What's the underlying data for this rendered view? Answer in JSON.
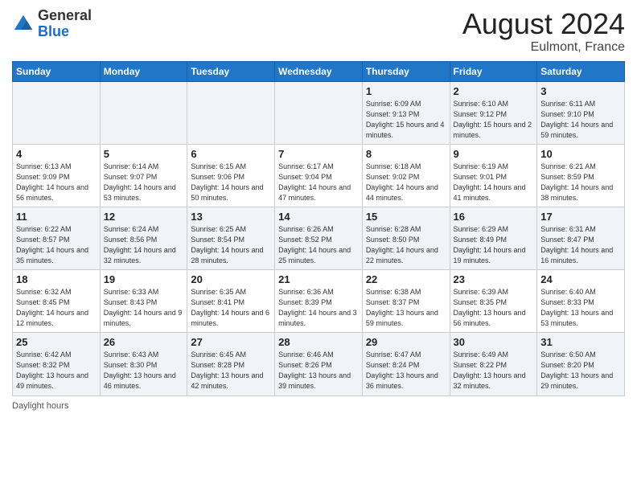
{
  "header": {
    "logo_general": "General",
    "logo_blue": "Blue",
    "month_title": "August 2024",
    "location": "Eulmont, France"
  },
  "days_of_week": [
    "Sunday",
    "Monday",
    "Tuesday",
    "Wednesday",
    "Thursday",
    "Friday",
    "Saturday"
  ],
  "footer_label": "Daylight hours",
  "weeks": [
    [
      {
        "day": "",
        "info": ""
      },
      {
        "day": "",
        "info": ""
      },
      {
        "day": "",
        "info": ""
      },
      {
        "day": "",
        "info": ""
      },
      {
        "day": "1",
        "info": "Sunrise: 6:09 AM\nSunset: 9:13 PM\nDaylight: 15 hours\nand 4 minutes."
      },
      {
        "day": "2",
        "info": "Sunrise: 6:10 AM\nSunset: 9:12 PM\nDaylight: 15 hours\nand 2 minutes."
      },
      {
        "day": "3",
        "info": "Sunrise: 6:11 AM\nSunset: 9:10 PM\nDaylight: 14 hours\nand 59 minutes."
      }
    ],
    [
      {
        "day": "4",
        "info": "Sunrise: 6:13 AM\nSunset: 9:09 PM\nDaylight: 14 hours\nand 56 minutes."
      },
      {
        "day": "5",
        "info": "Sunrise: 6:14 AM\nSunset: 9:07 PM\nDaylight: 14 hours\nand 53 minutes."
      },
      {
        "day": "6",
        "info": "Sunrise: 6:15 AM\nSunset: 9:06 PM\nDaylight: 14 hours\nand 50 minutes."
      },
      {
        "day": "7",
        "info": "Sunrise: 6:17 AM\nSunset: 9:04 PM\nDaylight: 14 hours\nand 47 minutes."
      },
      {
        "day": "8",
        "info": "Sunrise: 6:18 AM\nSunset: 9:02 PM\nDaylight: 14 hours\nand 44 minutes."
      },
      {
        "day": "9",
        "info": "Sunrise: 6:19 AM\nSunset: 9:01 PM\nDaylight: 14 hours\nand 41 minutes."
      },
      {
        "day": "10",
        "info": "Sunrise: 6:21 AM\nSunset: 8:59 PM\nDaylight: 14 hours\nand 38 minutes."
      }
    ],
    [
      {
        "day": "11",
        "info": "Sunrise: 6:22 AM\nSunset: 8:57 PM\nDaylight: 14 hours\nand 35 minutes."
      },
      {
        "day": "12",
        "info": "Sunrise: 6:24 AM\nSunset: 8:56 PM\nDaylight: 14 hours\nand 32 minutes."
      },
      {
        "day": "13",
        "info": "Sunrise: 6:25 AM\nSunset: 8:54 PM\nDaylight: 14 hours\nand 28 minutes."
      },
      {
        "day": "14",
        "info": "Sunrise: 6:26 AM\nSunset: 8:52 PM\nDaylight: 14 hours\nand 25 minutes."
      },
      {
        "day": "15",
        "info": "Sunrise: 6:28 AM\nSunset: 8:50 PM\nDaylight: 14 hours\nand 22 minutes."
      },
      {
        "day": "16",
        "info": "Sunrise: 6:29 AM\nSunset: 8:49 PM\nDaylight: 14 hours\nand 19 minutes."
      },
      {
        "day": "17",
        "info": "Sunrise: 6:31 AM\nSunset: 8:47 PM\nDaylight: 14 hours\nand 16 minutes."
      }
    ],
    [
      {
        "day": "18",
        "info": "Sunrise: 6:32 AM\nSunset: 8:45 PM\nDaylight: 14 hours\nand 12 minutes."
      },
      {
        "day": "19",
        "info": "Sunrise: 6:33 AM\nSunset: 8:43 PM\nDaylight: 14 hours\nand 9 minutes."
      },
      {
        "day": "20",
        "info": "Sunrise: 6:35 AM\nSunset: 8:41 PM\nDaylight: 14 hours\nand 6 minutes."
      },
      {
        "day": "21",
        "info": "Sunrise: 6:36 AM\nSunset: 8:39 PM\nDaylight: 14 hours\nand 3 minutes."
      },
      {
        "day": "22",
        "info": "Sunrise: 6:38 AM\nSunset: 8:37 PM\nDaylight: 13 hours\nand 59 minutes."
      },
      {
        "day": "23",
        "info": "Sunrise: 6:39 AM\nSunset: 8:35 PM\nDaylight: 13 hours\nand 56 minutes."
      },
      {
        "day": "24",
        "info": "Sunrise: 6:40 AM\nSunset: 8:33 PM\nDaylight: 13 hours\nand 53 minutes."
      }
    ],
    [
      {
        "day": "25",
        "info": "Sunrise: 6:42 AM\nSunset: 8:32 PM\nDaylight: 13 hours\nand 49 minutes."
      },
      {
        "day": "26",
        "info": "Sunrise: 6:43 AM\nSunset: 8:30 PM\nDaylight: 13 hours\nand 46 minutes."
      },
      {
        "day": "27",
        "info": "Sunrise: 6:45 AM\nSunset: 8:28 PM\nDaylight: 13 hours\nand 42 minutes."
      },
      {
        "day": "28",
        "info": "Sunrise: 6:46 AM\nSunset: 8:26 PM\nDaylight: 13 hours\nand 39 minutes."
      },
      {
        "day": "29",
        "info": "Sunrise: 6:47 AM\nSunset: 8:24 PM\nDaylight: 13 hours\nand 36 minutes."
      },
      {
        "day": "30",
        "info": "Sunrise: 6:49 AM\nSunset: 8:22 PM\nDaylight: 13 hours\nand 32 minutes."
      },
      {
        "day": "31",
        "info": "Sunrise: 6:50 AM\nSunset: 8:20 PM\nDaylight: 13 hours\nand 29 minutes."
      }
    ]
  ]
}
